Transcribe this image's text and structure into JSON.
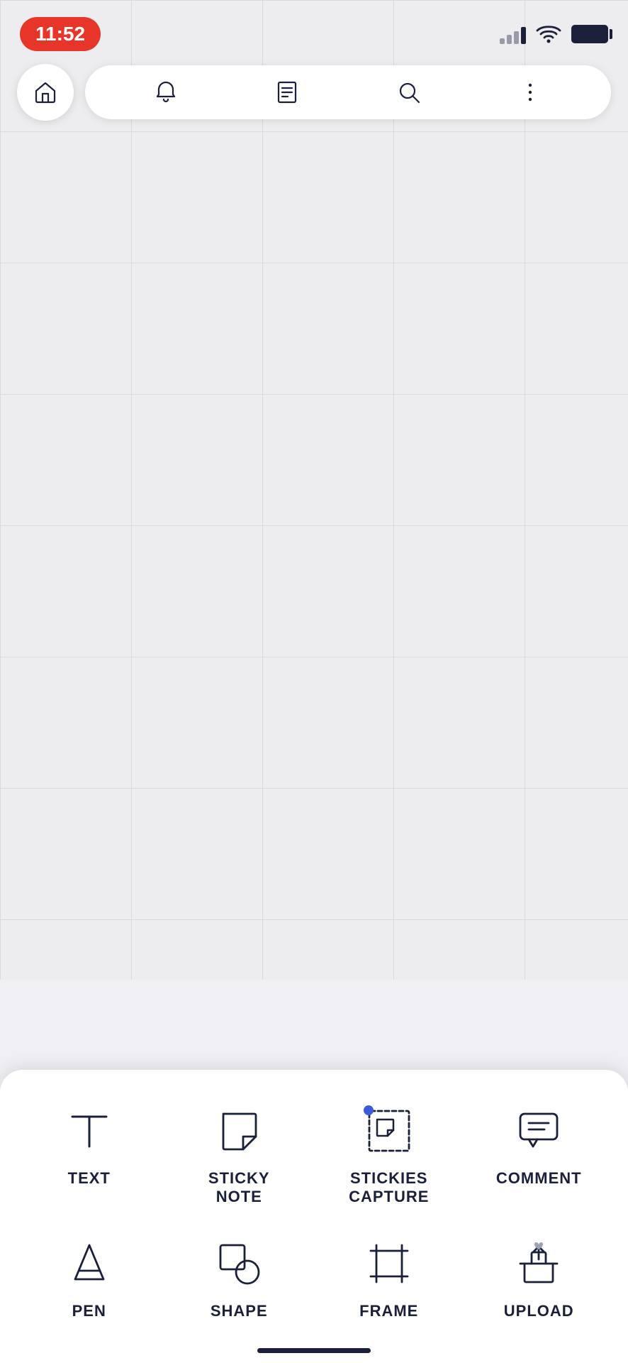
{
  "status_bar": {
    "time": "11:52",
    "signal_label": "signal",
    "wifi_label": "wifi",
    "battery_label": "battery"
  },
  "toolbar": {
    "home_label": "home",
    "notification_label": "notification",
    "document_label": "document",
    "search_label": "search",
    "more_label": "more options"
  },
  "tools": [
    {
      "id": "text",
      "label": "TEXT",
      "icon": "text-icon"
    },
    {
      "id": "sticky-note",
      "label": "STICKY\nNOTE",
      "label_line1": "STICKY",
      "label_line2": "NOTE",
      "icon": "sticky-note-icon"
    },
    {
      "id": "stickies-capture",
      "label": "STICKIES\nCAPTURE",
      "label_line1": "STICKIES",
      "label_line2": "CAPTURE",
      "icon": "stickies-capture-icon",
      "has_dot": true
    },
    {
      "id": "comment",
      "label": "COMMENT",
      "icon": "comment-icon"
    },
    {
      "id": "pen",
      "label": "PEN",
      "icon": "pen-icon"
    },
    {
      "id": "shape",
      "label": "SHAPE",
      "icon": "shape-icon"
    },
    {
      "id": "frame",
      "label": "FRAME",
      "icon": "frame-icon"
    },
    {
      "id": "upload",
      "label": "UPLOAD",
      "icon": "upload-icon"
    }
  ]
}
